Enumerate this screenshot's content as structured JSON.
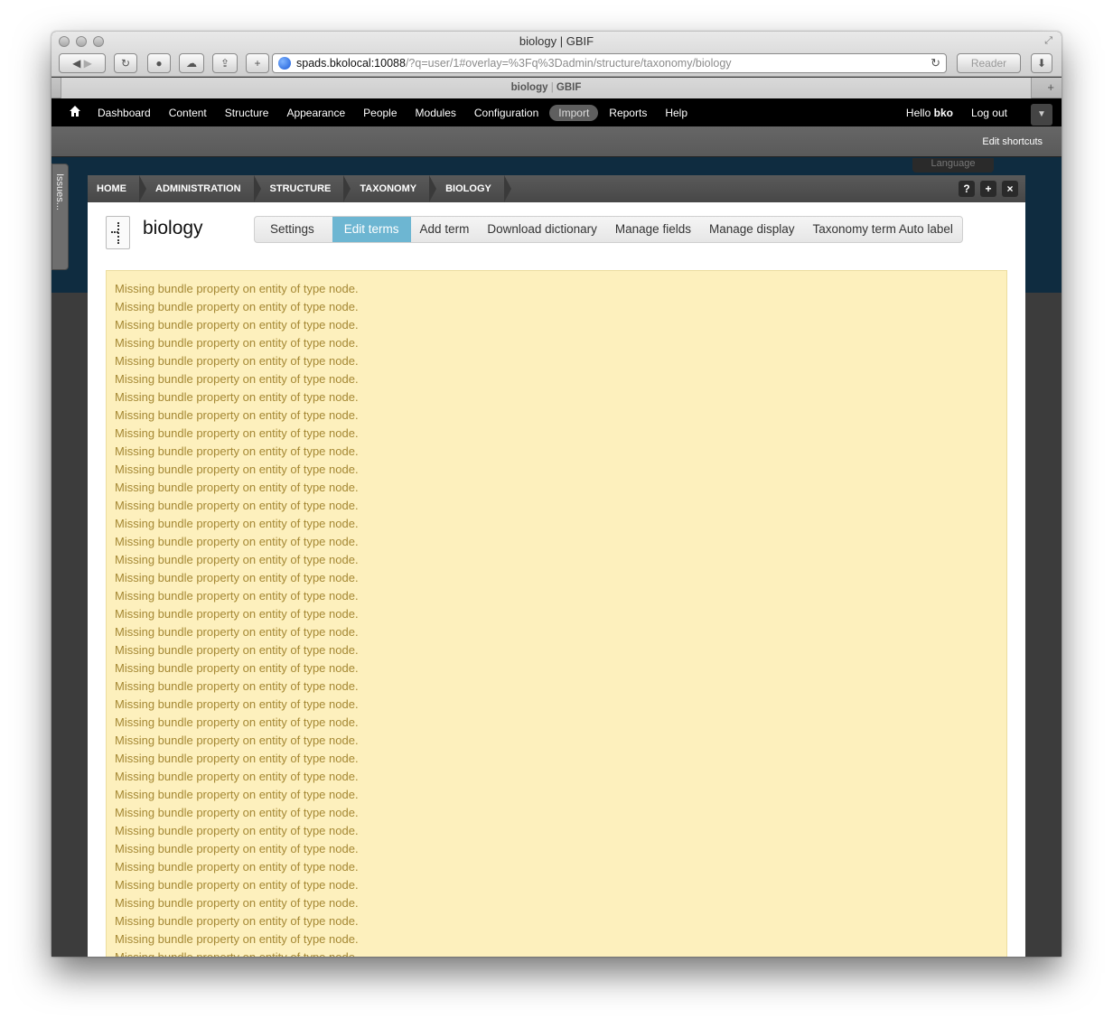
{
  "browser": {
    "window_title": "biology | GBIF",
    "url_host": "spads.bkolocal:10088",
    "url_path": "/?q=user/1#overlay=%3Fq%3Dadmin/structure/taxonomy/biology",
    "reader_label": "Reader",
    "tab_title_left": "biology",
    "tab_title_sep": "|",
    "tab_title_right": "GBIF"
  },
  "toolbar": {
    "menu": [
      "Dashboard",
      "Content",
      "Structure",
      "Appearance",
      "People",
      "Modules",
      "Configuration",
      "Import",
      "Reports",
      "Help"
    ],
    "active_item": "Import",
    "hello": "Hello",
    "username": "bko",
    "logout": "Log out",
    "edit_shortcuts": "Edit shortcuts"
  },
  "background": {
    "language": "Language",
    "issues_tab": "Issues..."
  },
  "overlay": {
    "breadcrumb": [
      "HOME",
      "ADMINISTRATION",
      "STRUCTURE",
      "TAXONOMY",
      "BIOLOGY"
    ],
    "buttons": {
      "help": "?",
      "add": "+",
      "close": "×"
    },
    "title": "biology",
    "tabs": {
      "settings": "Settings",
      "edit_terms": "Edit terms",
      "add_term": "Add term",
      "download_dictionary": "Download dictionary",
      "manage_fields": "Manage fields",
      "manage_display": "Manage display",
      "auto_label": "Taxonomy term Auto label"
    },
    "message_text": "Missing bundle property on entity of type node.",
    "message_count": 38
  },
  "colors": {
    "message_bg": "#fdf0bd",
    "message_text": "#a58834",
    "active_tab": "#6db6d2"
  }
}
